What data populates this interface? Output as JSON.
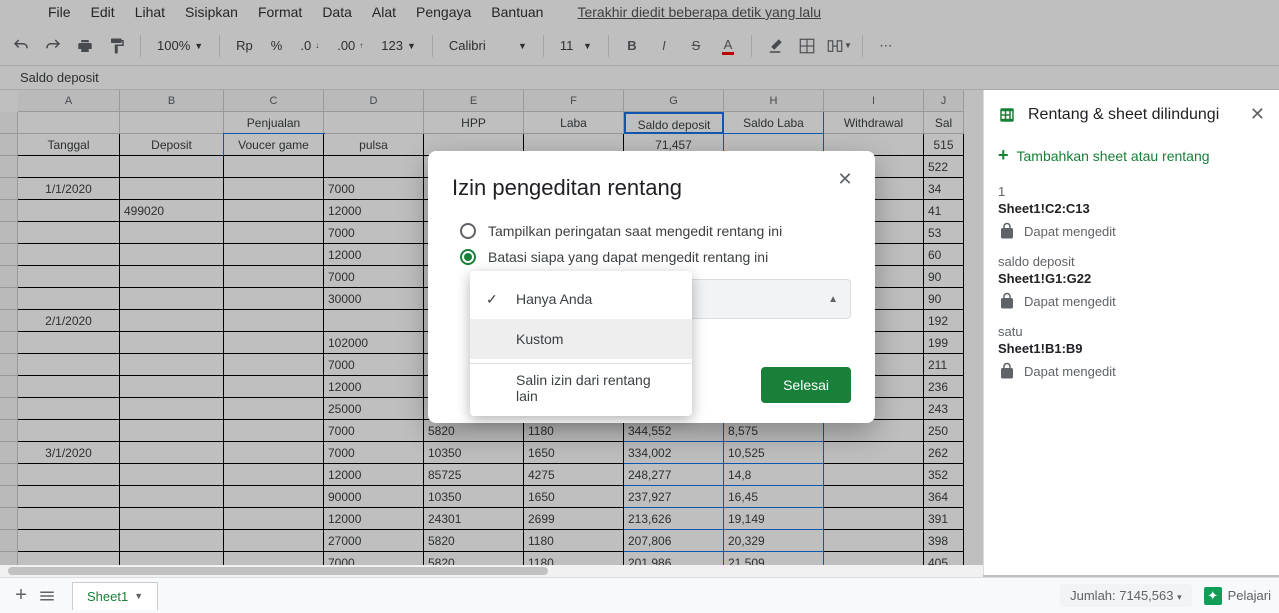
{
  "menu": [
    "File",
    "Edit",
    "Lihat",
    "Sisipkan",
    "Format",
    "Data",
    "Alat",
    "Pengaya",
    "Bantuan"
  ],
  "last_edit": "Terakhir diedit beberapa detik yang lalu",
  "toolbar": {
    "zoom": "100%",
    "currency": "Rp",
    "pct": "%",
    "123": "123",
    "font": "Calibri",
    "size": "11"
  },
  "formula_bar": "Saldo deposit",
  "columns": [
    {
      "l": "A",
      "w": 102
    },
    {
      "l": "B",
      "w": 104
    },
    {
      "l": "C",
      "w": 100
    },
    {
      "l": "D",
      "w": 100
    },
    {
      "l": "E",
      "w": 100
    },
    {
      "l": "F",
      "w": 100
    },
    {
      "l": "G",
      "w": 100
    },
    {
      "l": "H",
      "w": 100
    },
    {
      "l": "I",
      "w": 100
    },
    {
      "l": "J",
      "w": 40
    }
  ],
  "cells": [
    [
      "",
      "",
      "Penjualan",
      "",
      "HPP",
      "Laba",
      "Saldo deposit",
      "Saldo Laba",
      "Withdrawal",
      "Sal"
    ],
    [
      "Tanggal",
      "Deposit",
      "Voucer game",
      "pulsa",
      "",
      "",
      "71,457",
      "",
      "",
      "515"
    ],
    [
      "",
      "",
      "",
      "",
      "",
      "",
      "",
      "",
      "",
      "522"
    ],
    [
      "1/1/2020",
      "",
      "",
      "7000",
      "",
      "",
      "",
      "",
      "",
      "34"
    ],
    [
      "",
      "499020",
      "",
      "12000",
      "",
      "",
      "",
      "",
      "",
      "41"
    ],
    [
      "",
      "",
      "",
      "7000",
      "",
      "",
      "",
      "",
      "",
      "53"
    ],
    [
      "",
      "",
      "",
      "12000",
      "",
      "",
      "",
      "",
      "",
      "60"
    ],
    [
      "",
      "",
      "",
      "7000",
      "",
      "",
      "",
      "",
      "",
      "90"
    ],
    [
      "",
      "",
      "",
      "30000",
      "",
      "",
      "",
      "",
      "",
      "90"
    ],
    [
      "2/1/2020",
      "",
      "",
      "",
      "",
      "",
      "",
      "",
      "",
      "192"
    ],
    [
      "",
      "",
      "",
      "102000",
      "",
      "",
      "",
      "",
      "",
      "199"
    ],
    [
      "",
      "",
      "",
      "7000",
      "",
      "",
      "",
      "",
      "",
      "211"
    ],
    [
      "",
      "",
      "",
      "12000",
      "",
      "",
      "",
      "",
      "",
      "236"
    ],
    [
      "",
      "",
      "",
      "25000",
      "",
      "",
      "",
      "",
      "",
      "243"
    ],
    [
      "",
      "",
      "",
      "7000",
      "5820",
      "1180",
      "344,552",
      "8,575",
      "",
      "250"
    ],
    [
      "3/1/2020",
      "",
      "",
      "7000",
      "10350",
      "1650",
      "334,002",
      "10,525",
      "",
      "262"
    ],
    [
      "",
      "",
      "",
      "12000",
      "85725",
      "4275",
      "248,277",
      "14,8",
      "",
      "352"
    ],
    [
      "",
      "",
      "",
      "90000",
      "10350",
      "1650",
      "237,927",
      "16,45",
      "",
      "364"
    ],
    [
      "",
      "",
      "",
      "12000",
      "24301",
      "2699",
      "213,626",
      "19,149",
      "",
      "391"
    ],
    [
      "",
      "",
      "",
      "27000",
      "5820",
      "1180",
      "207,806",
      "20,329",
      "",
      "398"
    ],
    [
      "",
      "",
      "",
      "7000",
      "5820",
      "1180",
      "201,986",
      "21,509",
      "",
      "405"
    ]
  ],
  "side": {
    "title": "Rentang & sheet dilindungi",
    "add": "Tambahkan sheet atau rentang",
    "items": [
      {
        "name": "1",
        "detail": "Sheet1!C2:C13",
        "perm": "Dapat mengedit"
      },
      {
        "name": "saldo deposit",
        "detail": "Sheet1!G1:G22",
        "perm": "Dapat mengedit"
      },
      {
        "name": "satu",
        "detail": "Sheet1!B1:B9",
        "perm": "Dapat mengedit"
      }
    ]
  },
  "dialog": {
    "title": "Izin pengeditan rentang",
    "radio1": "Tampilkan peringatan saat mengedit rentang ini",
    "radio2": "Batasi siapa yang dapat mengedit rentang ini",
    "opts": [
      "Hanya Anda",
      "Kustom",
      "Salin izin dari rentang lain"
    ],
    "done": "Selesai"
  },
  "bottom": {
    "sheet": "Sheet1",
    "sum": "Jumlah: 7145,563",
    "explore": "Pelajari"
  }
}
